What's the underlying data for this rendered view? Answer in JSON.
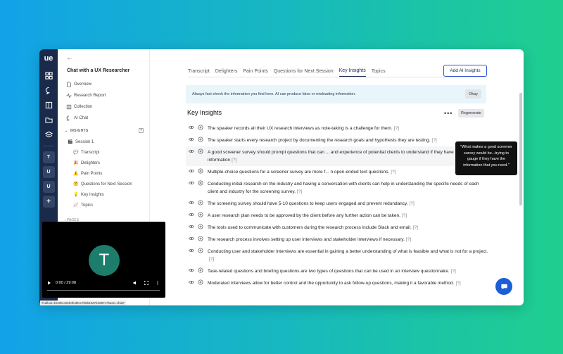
{
  "rail": {
    "logo": "ue",
    "icons": [
      "grid-icon",
      "chat-bubble-icon",
      "book-icon",
      "folder-icon",
      "layers-icon"
    ],
    "users": [
      "T",
      "U",
      "U"
    ],
    "add": "+"
  },
  "side": {
    "title": "Chat with a UX Researcher",
    "nav": [
      {
        "label": "Overview",
        "icon": "document-icon"
      },
      {
        "label": "Research Report",
        "icon": "pulse-icon"
      },
      {
        "label": "Collection",
        "icon": "book-icon"
      },
      {
        "label": "AI Chat",
        "icon": "chat-bubble-icon"
      }
    ],
    "section": "INSIGHTS",
    "session": {
      "label": "Session 1",
      "emoji": "🎬"
    },
    "children": [
      {
        "label": "Transcript",
        "emoji": "💬"
      },
      {
        "label": "Delighters",
        "emoji": "🎉"
      },
      {
        "label": "Pain Points",
        "emoji": "⚠️"
      },
      {
        "label": "Questions for Next Session",
        "emoji": "🤔"
      },
      {
        "label": "Key Insights",
        "emoji": "💡"
      },
      {
        "label": "Topics",
        "emoji": "📈"
      }
    ],
    "pages": "PAGES"
  },
  "main": {
    "tabs": [
      "Transcript",
      "Delighters",
      "Pain Points",
      "Questions for Next Session",
      "Key Insights",
      "Topics"
    ],
    "active_tab": "Key Insights",
    "add_ai": "Add AI Insights",
    "notice": "Always fact-check the information you find here. AI can produce false or misleading information.",
    "okay": "Okay",
    "heading": "Key Insights",
    "more": "•••",
    "regenerate": "Regenerate",
    "tooltip": "\"What makes a good screener survey would be...trying to gauge if they have the information that you need.\"",
    "insights": [
      {
        "text": "The speaker records all their UX research interviews as note-taking is a challenge for them.",
        "ref": "[?]"
      },
      {
        "text": "The speaker starts every research project by documenting the research goals and hypothesis they are testing.",
        "ref": "[?]"
      },
      {
        "text": "A good screener survey should prompt questions that can ... and experience of potential clients to understand if they have the necessary information",
        "ref": "[?]"
      },
      {
        "text": "Multiple-choice questions for a screener survey are more f... n open-ended text questions.",
        "ref": "[?]"
      },
      {
        "text": "Conducting initial research on the industry and having a conversation with clients can help in understanding the specific needs of each client and industry for the screening survey.",
        "ref": "[?]"
      },
      {
        "text": "The screening survey should have 5-10 questions to keep users engaged and prevent redundancy.",
        "ref": "[?]"
      },
      {
        "text": "A user research plan needs to be approved by the client before any further action can be taken.",
        "ref": "[?]"
      },
      {
        "text": "The tools used to communicate with customers during the research process include Slack and email.",
        "ref": "[?]"
      },
      {
        "text": "The research process involves setting up user interviews and stakeholder interviews if necessary.",
        "ref": "[?]"
      },
      {
        "text": "Conducting user and stakeholder interviews are essential in gaining a better understanding of what is feasible and what is not for a project.",
        "ref": "[?]"
      },
      {
        "text": "Task-related questions and briefing questions are two types of questions that can be used in an interview questionnaire.",
        "ref": "[?]"
      },
      {
        "text": "Moderated interviews allow for better control and the opportunity to ask follow-up questions, making it a favorable method.",
        "ref": "[?]"
      }
    ]
  },
  "video": {
    "avatar": "T",
    "time": "0:00 / 29:08"
  },
  "url": "#callout-4040bc49cb4fcd9cc7b0b4327b4987c?base=chat#"
}
